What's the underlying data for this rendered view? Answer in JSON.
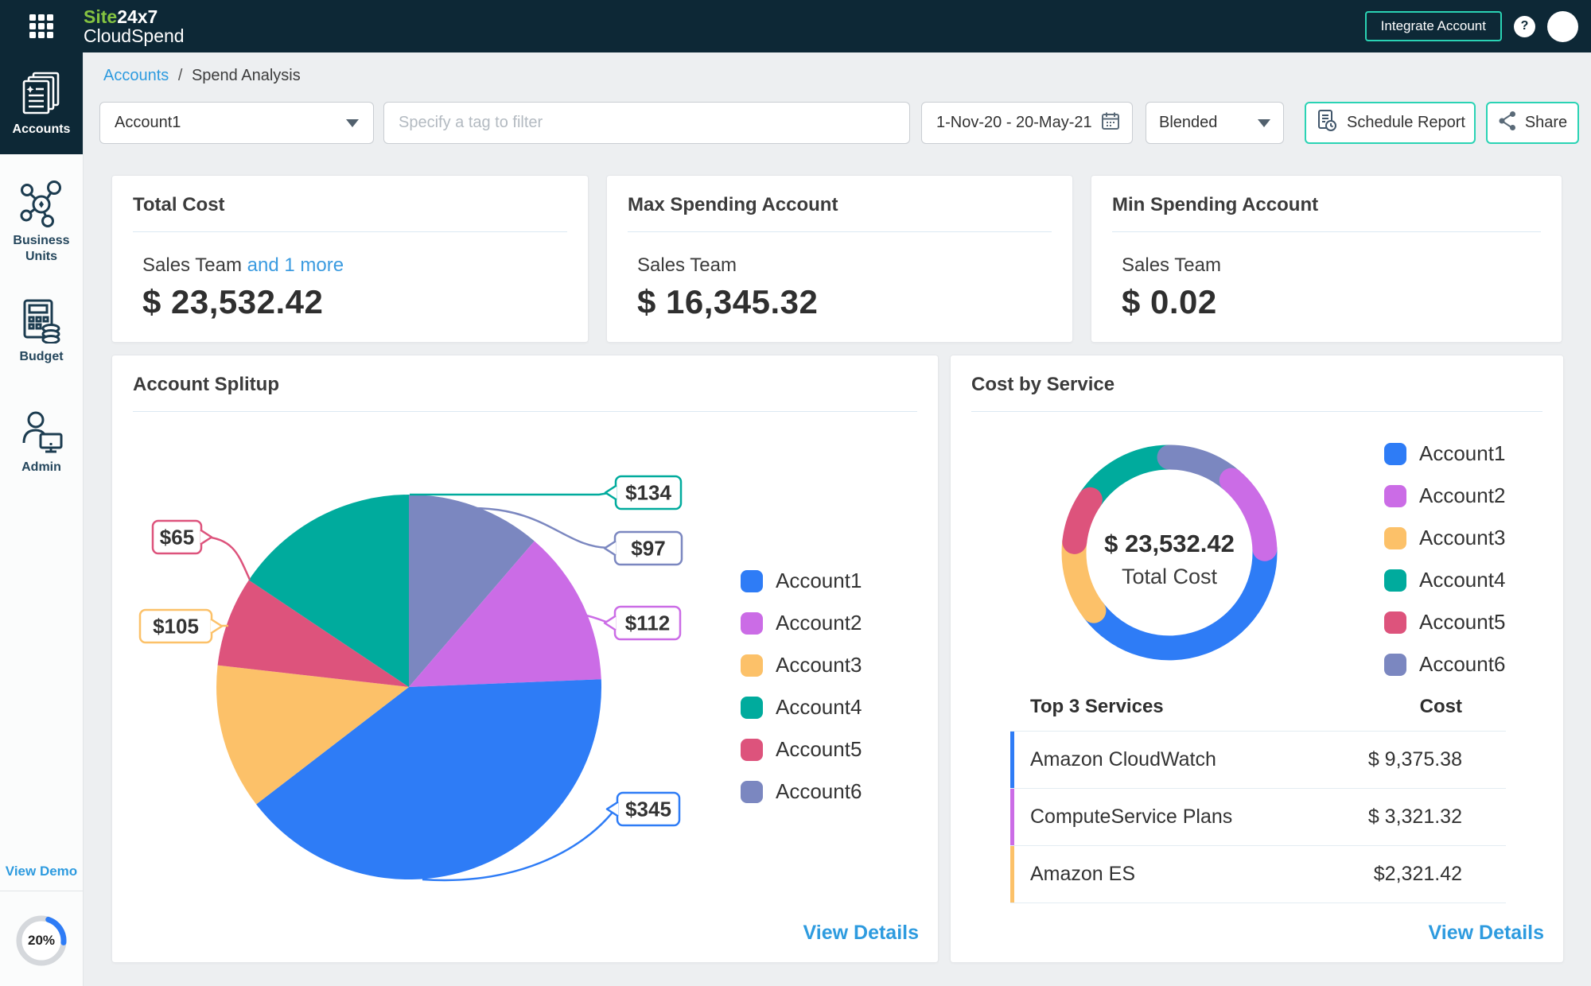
{
  "topbar": {
    "logo_part_green": "Site",
    "logo_part_white": "24x7",
    "logo_line2": "CloudSpend",
    "integrate_button": "Integrate Account",
    "help_label": "?"
  },
  "sidebar": {
    "items": [
      {
        "label": "Accounts",
        "active": true
      },
      {
        "label": "Business Units",
        "active": false
      },
      {
        "label": "Budget",
        "active": false
      },
      {
        "label": "Admin",
        "active": false
      }
    ],
    "view_demo": "View Demo",
    "progress_percent": "20%"
  },
  "breadcrumb": {
    "link": "Accounts",
    "separator": "/",
    "current": "Spend Analysis"
  },
  "filters": {
    "account_select_value": "Account1",
    "tag_placeholder": "Specify a tag to filter",
    "date_range": "1-Nov-20 - 20-May-21",
    "cost_type_value": "Blended",
    "schedule_report_label": "Schedule Report",
    "share_label": "Share"
  },
  "stats": [
    {
      "title": "Total Cost",
      "account": "Sales Team",
      "more": "and 1 more",
      "value": "$ 23,532.42"
    },
    {
      "title": "Max Spending Account",
      "account": "Sales Team",
      "value": "$ 16,345.32"
    },
    {
      "title": "Min Spending Account",
      "account": "Sales Team",
      "value": "$ 0.02"
    }
  ],
  "account_splitup": {
    "title": "Account Splitup",
    "view_details": "View Details"
  },
  "cost_by_service": {
    "title": "Cost by Service",
    "center_value": "$ 23,532.42",
    "center_label": "Total Cost",
    "table": {
      "col1": "Top 3 Services",
      "col2": "Cost",
      "rows": [
        {
          "service": "Amazon CloudWatch",
          "cost": "$ 9,375.38",
          "color": "#2e7cf6"
        },
        {
          "service": "ComputeService Plans",
          "cost": "$ 3,321.32",
          "color": "#cb6ce6"
        },
        {
          "service": "Amazon ES",
          "cost": "$2,321.42",
          "color": "#fcc169"
        }
      ]
    },
    "view_details": "View Details"
  },
  "icons": {
    "topbar": [
      "app-grid-icon",
      "help-icon",
      "avatar"
    ],
    "sidebar": [
      "accounts-icon",
      "business-units-icon",
      "budget-icon",
      "admin-icon"
    ],
    "filters": [
      "dropdown-arrow-icon",
      "calendar-icon",
      "schedule-report-icon",
      "share-icon"
    ]
  },
  "chart_data": [
    {
      "type": "pie",
      "title": "Account Splitup",
      "series": [
        {
          "name": "Account1",
          "value": 345,
          "label": "$345",
          "color": "#2e7cf6"
        },
        {
          "name": "Account2",
          "value": 112,
          "label": "$112",
          "color": "#cb6ce6"
        },
        {
          "name": "Account3",
          "value": 105,
          "label": "$105",
          "color": "#fcc169"
        },
        {
          "name": "Account4",
          "value": 134,
          "label": "$134",
          "color": "#00ab9d"
        },
        {
          "name": "Account5",
          "value": 65,
          "label": "$65",
          "color": "#dd537c"
        },
        {
          "name": "Account6",
          "value": 97,
          "label": "$97",
          "color": "#7b87c0"
        }
      ],
      "clockwise_order_from_top": [
        "Account6",
        "Account2",
        "Account1",
        "Account3",
        "Account5",
        "Account4"
      ],
      "total": 858,
      "legend_position": "right",
      "data_labels": "currency callouts"
    },
    {
      "type": "donut",
      "title": "Cost by Service",
      "center_value": "$ 23,532.42",
      "center_label": "Total Cost",
      "series": [
        {
          "name": "Account1",
          "value": 345,
          "color": "#2e7cf6"
        },
        {
          "name": "Account2",
          "value": 112,
          "color": "#cb6ce6"
        },
        {
          "name": "Account3",
          "value": 105,
          "color": "#fcc169"
        },
        {
          "name": "Account4",
          "value": 134,
          "color": "#00ab9d"
        },
        {
          "name": "Account5",
          "value": 65,
          "color": "#dd537c"
        },
        {
          "name": "Account6",
          "value": 97,
          "color": "#7b87c0"
        }
      ],
      "clockwise_order_from_top": [
        "Account6",
        "Account2",
        "Account1",
        "Account3",
        "Account5",
        "Account4"
      ],
      "legend_position": "right",
      "top_services": [
        {
          "service": "Amazon CloudWatch",
          "cost": 9375.38
        },
        {
          "service": "ComputeService Plans",
          "cost": 3321.32
        },
        {
          "service": "Amazon ES",
          "cost": 2321.42
        }
      ]
    }
  ]
}
